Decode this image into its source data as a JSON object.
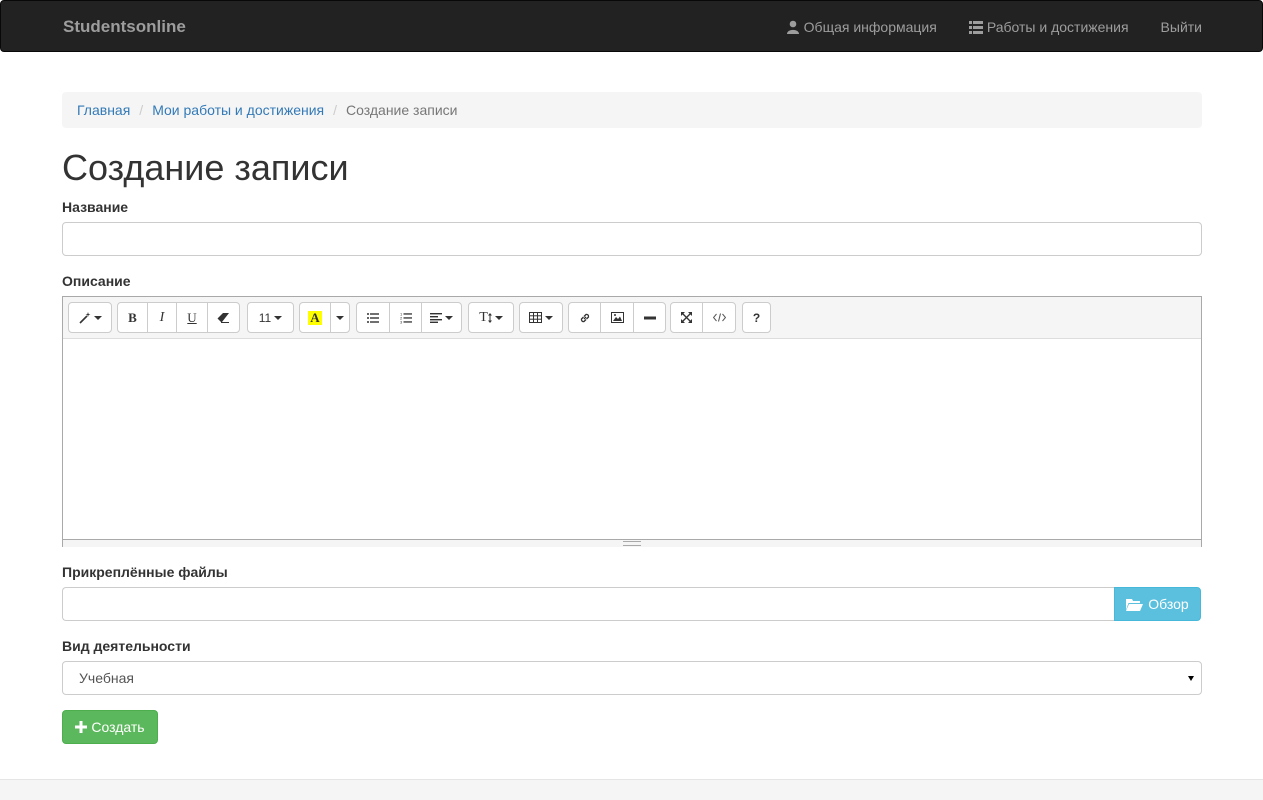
{
  "navbar": {
    "brand": "Studentsonline",
    "links": [
      {
        "label": "Общая информация",
        "icon": "user-icon"
      },
      {
        "label": "Работы и достижения",
        "icon": "list-icon"
      },
      {
        "label": "Выйти"
      }
    ]
  },
  "breadcrumb": [
    "Главная",
    "Мои работы и достижения",
    "Создание записи"
  ],
  "page_title": "Создание записи",
  "form": {
    "title_label": "Название",
    "title_value": "",
    "description_label": "Описание",
    "editor": {
      "font_size": "11",
      "highlight_letter": "A",
      "highlight_color": "#ffff00",
      "style_letter": "T",
      "help": "?",
      "tools": [
        "magic-icon",
        "bold-icon",
        "italic-icon",
        "underline-icon",
        "eraser-icon",
        "font-size-dropdown",
        "highlight-color-button",
        "color-dropdown",
        "unordered-list-icon",
        "ordered-list-icon",
        "align-icon",
        "line-height-icon",
        "table-icon",
        "link-icon",
        "picture-icon",
        "horizontal-rule-icon",
        "fullscreen-icon",
        "code-view-icon",
        "help-button"
      ]
    },
    "files_label": "Прикреплённые файлы",
    "browse_label": "Обзор",
    "activity_label": "Вид деятельности",
    "activity_value": "Учебная",
    "submit_label": "Создать"
  },
  "colors": {
    "navbar_bg": "#222222",
    "link": "#337ab7",
    "info": "#5bc0de",
    "success": "#5cb85c"
  }
}
